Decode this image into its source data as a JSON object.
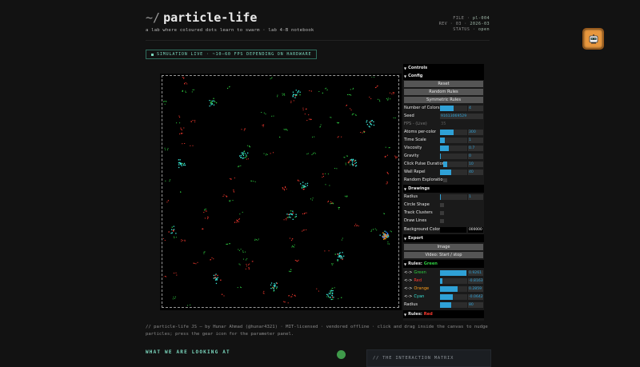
{
  "header": {
    "prefix": "~/",
    "title": "particle-life",
    "subtitle": "a lab where coloured dots learn to swarm · lab 4-B notebook",
    "meta": {
      "file_label": "FILE ·",
      "file_value": "pl-004",
      "rev_label": "REV · 03 ·",
      "rev_value": "2026-03",
      "status_label": "STATUS ·",
      "status_value": "open"
    },
    "status_pill": "SIMULATION LIVE · ~10–60 FPS DEPENDING ON HARDWARE"
  },
  "gui": {
    "controls_title": "Controls",
    "config": {
      "title": "Config",
      "buttons": [
        "Reset",
        "Random Rules",
        "Symmetric Rules"
      ],
      "number_of_colors": {
        "label": "Number of Colors",
        "value": "4",
        "level": 0.5
      },
      "seed": {
        "label": "Seed",
        "value": "91613069529"
      },
      "fps": {
        "label": "FPS - (Live)",
        "value": "35"
      },
      "atoms_per_color": {
        "label": "Atoms per-color",
        "value": "300",
        "level": 0.5
      },
      "time_scale": {
        "label": "Time Scale",
        "value": "1",
        "level": 0.18
      },
      "viscosity": {
        "label": "Viscosity",
        "value": "0.7",
        "level": 0.32
      },
      "gravity": {
        "label": "Gravity",
        "value": "0",
        "level": 0.0
      },
      "click_pulse": {
        "label": "Click Pulse Duration",
        "value": "10",
        "level": 0.16
      },
      "wall_repel": {
        "label": "Wall Repel",
        "value": "40",
        "level": 0.4
      },
      "random_exploration": {
        "label": "Random Exploration"
      }
    },
    "drawings": {
      "title": "Drawings",
      "radius": {
        "label": "Radius",
        "value": "1",
        "level": 0.0
      },
      "circle_shape": "Circle Shape",
      "track_clusters": "Track Clusters",
      "draw_lines": "Draw Lines",
      "background_color": {
        "label": "Background Color",
        "value": "000000"
      }
    },
    "export": {
      "title": "Export",
      "image": "Image",
      "video": "Video: Start / stop"
    },
    "rules_green": {
      "title": "Rules:",
      "title_color": "Green",
      "rows": [
        {
          "arrow": "<->",
          "name": "Green",
          "color": "#2ecc40",
          "value": "0.9261",
          "level": 0.96
        },
        {
          "arrow": "<->",
          "name": "Red",
          "color": "#ff3b30",
          "value": "-0.8163",
          "level": 0.09
        },
        {
          "arrow": "<->",
          "name": "Orange",
          "color": "#ff9f1a",
          "value": "0.2859",
          "level": 0.64
        },
        {
          "arrow": "<->",
          "name": "Cyan",
          "color": "#39e6d8",
          "value": "-0.0642",
          "level": 0.47
        }
      ],
      "radius": {
        "label": "Radius",
        "value": "80",
        "level": 0.4
      }
    },
    "rules_red": {
      "title": "Rules:",
      "title_color": "Red"
    }
  },
  "footer_note": "// particle-life JS — by Hunar Ahmad (@hunar4321) · MIT-licensed · vendored offline · click and drag inside the canvas to nudge particles; press the gear icon for the parameter panel.",
  "section_head": "WHAT WE ARE LOOKING AT",
  "matrix_card": "// THE INTERACTION MATRIX",
  "colors": {
    "green": "#2ecc40",
    "red": "#ff3b30",
    "orange": "#ff9f1a",
    "cyan": "#39e6d8",
    "accent": "#7ad6bd",
    "slider": "#2fa1d6"
  }
}
